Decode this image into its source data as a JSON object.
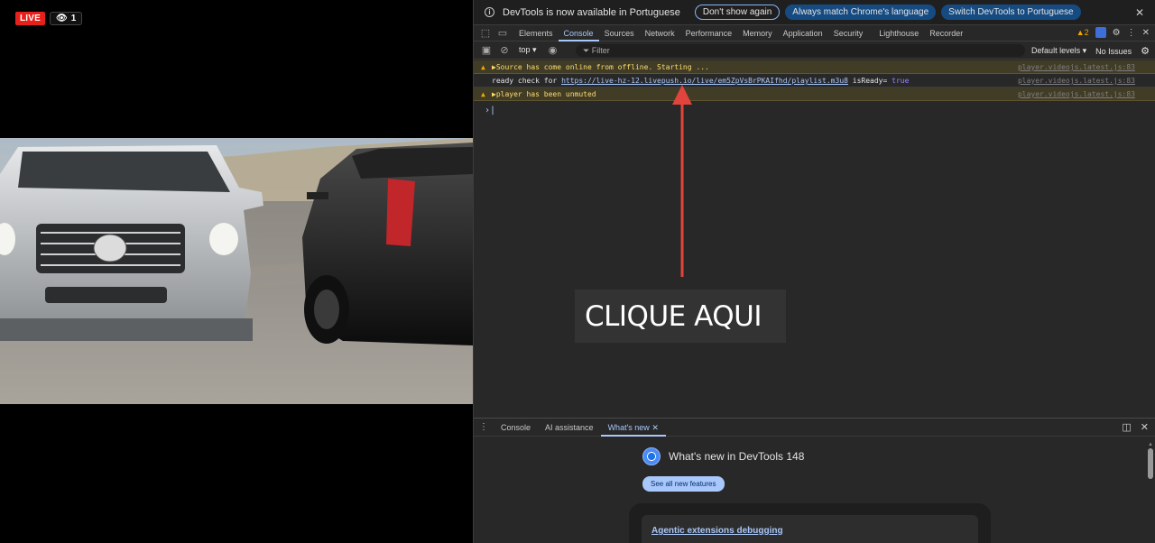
{
  "video": {
    "live_label": "LIVE",
    "viewer_count": "1"
  },
  "devtools": {
    "infobar": {
      "message": "DevTools is now available in Portuguese",
      "dont_show": "Don't show again",
      "always_match": "Always match Chrome's language",
      "switch": "Switch DevTools to Portuguese"
    },
    "tabs": [
      "Elements",
      "Console",
      "Sources",
      "Network",
      "Performance",
      "Memory",
      "Application",
      "Security",
      "Lighthouse",
      "Recorder"
    ],
    "active_tab": "Console",
    "warning_count": "2",
    "toolbar": {
      "context": "top ▾",
      "filter_placeholder": "Filter",
      "levels": "Default levels ▾",
      "issues": "No Issues"
    },
    "console": [
      {
        "type": "warn",
        "text": "▶Source has come online from offline. Starting ...",
        "source": "player.videojs.latest.js:83"
      },
      {
        "type": "normal",
        "prefix": "ready check for ",
        "link": "https://live-hz-12.livepush.io/live/em5ZpVsBrPKAIfhd/playlist.m3u8",
        "mid": " isReady= ",
        "value": "true",
        "source": "player.videojs.latest.js:83"
      },
      {
        "type": "warn",
        "text": "▶player has been unmuted",
        "source": "player.videojs.latest.js:83"
      }
    ],
    "annotation": "CLIQUE AQUI",
    "drawer": {
      "tabs": [
        "Console",
        "AI assistance",
        "What's new"
      ],
      "active": "What's new",
      "whats_new_title": "What's new in DevTools 148",
      "see_all": "See all new features",
      "card_link": "Agentic extensions debugging"
    },
    "colors": {
      "accent": "#a8c7fa",
      "warn_bg": "#413c26",
      "arrow": "#e0443c"
    }
  }
}
